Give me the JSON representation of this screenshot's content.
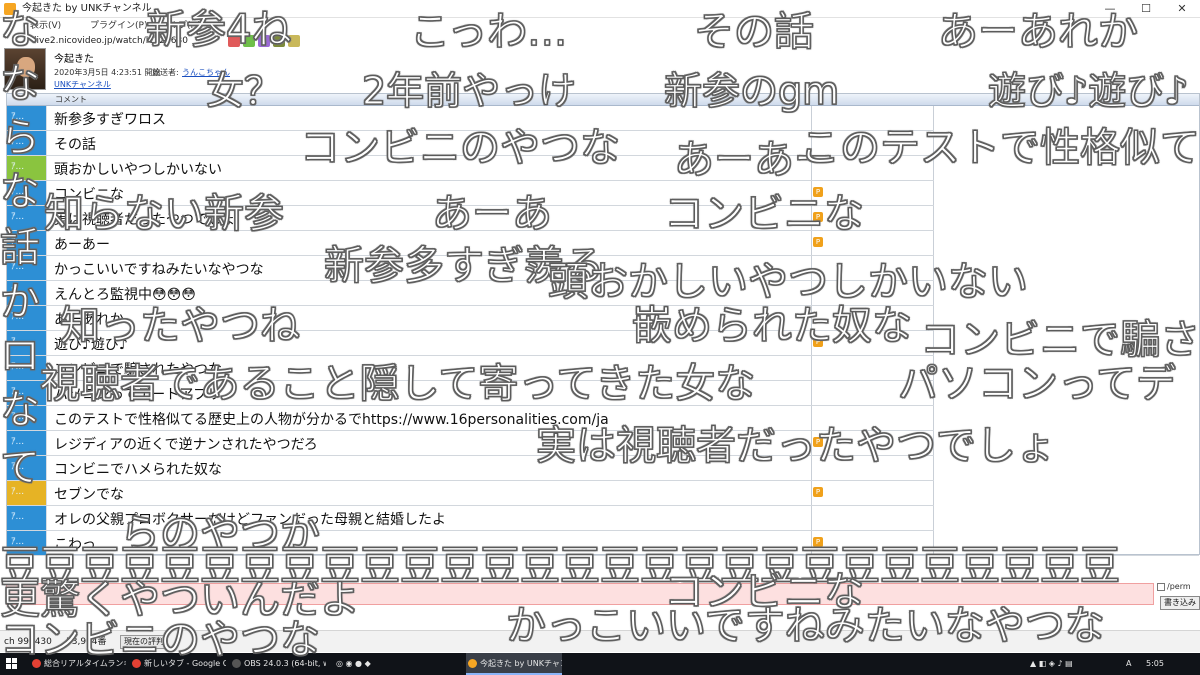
{
  "window": {
    "title": "今起きた by UNKチャンネル",
    "minimize": "—",
    "maximize": "☐",
    "close": "✕"
  },
  "menu": {
    "items": [
      "表示(V)",
      "プラグイン(P)",
      "ヘルプ(H)"
    ]
  },
  "address": {
    "url": "live2.nicovideo.jp/watch/lv324630"
  },
  "broadcast": {
    "title": "今起きた",
    "date": "2020年3月5日 4:23:51 開始",
    "owner_label": "放送者:",
    "owner": "うんこちゃん",
    "channel": "UNKチャンネル"
  },
  "comment_list": {
    "header": "コメント",
    "badge_mark": "ｱ...",
    "rows": [
      {
        "text": "新参多すぎワロス",
        "color": "#2d8fd5",
        "premium": false
      },
      {
        "text": "その話",
        "color": "#2d8fd5",
        "premium": false
      },
      {
        "text": "頭おかしいやつしかいない",
        "color": "#8ac43f",
        "premium": false
      },
      {
        "text": "コンビニな",
        "color": "#2d8fd5",
        "premium": true
      },
      {
        "text": "実は視聴者だったやつでしょ",
        "color": "#2d8fd5",
        "premium": true
      },
      {
        "text": "あーあー",
        "color": "#2d8fd5",
        "premium": true
      },
      {
        "text": "かっこいいですねみたいなやつな",
        "color": "#2d8fd5",
        "premium": false
      },
      {
        "text": "えんとろ監視中😳😳😳",
        "color": "#2d8fd5",
        "premium": false
      },
      {
        "text": "あーあれか",
        "color": "#2d8fd5",
        "premium": false
      },
      {
        "text": "遊び♪遊び♪",
        "color": "#2d8fd5",
        "premium": true
      },
      {
        "text": "コンビニで騙されたやつな",
        "color": "#2d8fd5",
        "premium": false
      },
      {
        "text": "パソコンってデートアプリ",
        "color": "#2d8fd5",
        "premium": false
      },
      {
        "text": "このテストで性格似てる歴史上の人物が分かるでhttps://www.16personalities.com/ja",
        "color": "#2d8fd5",
        "premium": false
      },
      {
        "text": "レジディアの近くで逆ナンされたやつだろ",
        "color": "#2d8fd5",
        "premium": true
      },
      {
        "text": "コンビニでハメられた奴な",
        "color": "#2d8fd5",
        "premium": false
      },
      {
        "text": "セブンでな",
        "color": "#e6b325",
        "premium": true
      },
      {
        "text": "オレの父親プロボクサーだけどファンだった母親と結婚したよ",
        "color": "#2d8fd5",
        "premium": false
      },
      {
        "text": "こわっ",
        "color": "#2d8fd5",
        "premium": true
      }
    ]
  },
  "post": {
    "perm_label": "/perm",
    "submit": "書き込み"
  },
  "status_bar": {
    "viewer": "ch 998430",
    "comment_no": "53,964番",
    "button": "現在の評判"
  },
  "taskbar": {
    "tasks": [
      {
        "label": "総合リアルタイムランキン...",
        "color": "#e44134"
      },
      {
        "label": "新しいタブ - Google Ch...",
        "color": "#e44134"
      },
      {
        "label": "OBS 24.0.3 (64-bit, wi...",
        "color": "#555555"
      },
      {
        "label": "今起きた by UNKチャン...",
        "color": "#f6a623"
      }
    ],
    "lang": "A",
    "clock": "5:05"
  },
  "overlay": [
    {
      "text": "な",
      "size": 40
    },
    {
      "text": "な",
      "size": 40
    },
    {
      "text": "ら",
      "size": 40
    },
    {
      "text": "な",
      "size": 40
    },
    {
      "text": "話",
      "size": 40
    },
    {
      "text": "か",
      "size": 40
    },
    {
      "text": "ロ",
      "size": 40
    },
    {
      "text": "な",
      "size": 40
    },
    {
      "text": "て",
      "size": 40
    },
    {
      "text": "新参4ね",
      "size": 40
    },
    {
      "text": "こっわ…",
      "size": 40
    },
    {
      "text": "その話",
      "size": 40
    },
    {
      "text": "あーあれか",
      "size": 40
    },
    {
      "text": "女？",
      "size": 38
    },
    {
      "text": "2年前やっけ",
      "size": 38
    },
    {
      "text": "新参のgm",
      "size": 38
    },
    {
      "text": "遊び♪遊び♪",
      "size": 38
    },
    {
      "text": "コンビニのやつな",
      "size": 40
    },
    {
      "text": "あーあー",
      "size": 40
    },
    {
      "text": "このテストで性格似て",
      "size": 40
    },
    {
      "text": "知らない新参",
      "size": 40
    },
    {
      "text": "あーあ",
      "size": 40
    },
    {
      "text": "コンビニな",
      "size": 40
    },
    {
      "text": "新参多すぎ羨る",
      "size": 40
    },
    {
      "text": "頭おかしいやつしかいない",
      "size": 40
    },
    {
      "text": "知ったやつね",
      "size": 40
    },
    {
      "text": "嵌められた奴な",
      "size": 40
    },
    {
      "text": "コンビニで騙さ",
      "size": 40
    },
    {
      "text": "視聴者であること隠して寄ってきた女な",
      "size": 40
    },
    {
      "text": "パソコンってデ",
      "size": 40
    },
    {
      "text": "実は視聴者だったやつでしょ",
      "size": 40
    },
    {
      "text": "らのやつか",
      "size": 40
    },
    {
      "text": "豆豆豆豆豆豆豆豆豆豆豆豆豆豆豆豆豆豆豆豆豆豆豆豆豆豆豆豆",
      "size": 40
    },
    {
      "text": "更驚くやついんだよ",
      "size": 40
    },
    {
      "text": "コンビニな",
      "size": 40
    },
    {
      "text": "コンビニのやつな",
      "size": 40
    },
    {
      "text": "かっこいいですねみたいなやつな",
      "size": 40
    }
  ]
}
